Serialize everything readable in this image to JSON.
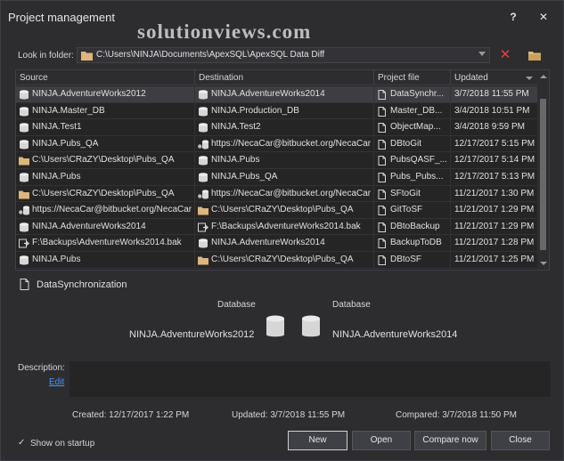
{
  "window": {
    "title": "Project management",
    "help_label": "?",
    "close_label": "✕",
    "watermark": "solutionviews.com"
  },
  "look_in": {
    "label": "Look in folder:",
    "path": "C:\\Users\\NINJA\\Documents\\ApexSQL\\ApexSQL Data Diff"
  },
  "grid": {
    "columns": [
      "Source",
      "Destination",
      "Project file",
      "Updated"
    ],
    "rows": [
      {
        "src": "NINJA.AdventureWorks2012",
        "src_icon": "database-icon",
        "dst": "NINJA.AdventureWorks2014",
        "dst_icon": "database-icon",
        "file": "DataSynchr...",
        "updated": "3/7/2018 11:55 PM"
      },
      {
        "src": "NINJA.Master_DB",
        "src_icon": "database-icon",
        "dst": "NINJA.Production_DB",
        "dst_icon": "database-icon",
        "file": "Master_DB...",
        "updated": "3/4/2018 10:51 PM"
      },
      {
        "src": "NINJA.Test1",
        "src_icon": "database-icon",
        "dst": "NINJA.Test2",
        "dst_icon": "database-icon",
        "file": "ObjectMap...",
        "updated": "3/4/2018 9:59 PM"
      },
      {
        "src": "NINJA.Pubs_QA",
        "src_icon": "database-icon",
        "dst": "https://NecaCar@bitbucket.org/NecaCar",
        "dst_icon": "source-control-icon",
        "file": "DBtoGit",
        "updated": "12/17/2017 5:15 PM"
      },
      {
        "src": "C:\\Users\\CRaZY\\Desktop\\Pubs_QA",
        "src_icon": "folder-icon",
        "dst": "NINJA.Pubs",
        "dst_icon": "database-icon",
        "file": "PubsQASF_...",
        "updated": "12/17/2017 5:14 PM"
      },
      {
        "src": "NINJA.Pubs",
        "src_icon": "database-icon",
        "dst": "NINJA.Pubs_QA",
        "dst_icon": "database-icon",
        "file": "Pubs_Pubs...",
        "updated": "12/17/2017 5:13 PM"
      },
      {
        "src": "C:\\Users\\CRaZY\\Desktop\\Pubs_QA",
        "src_icon": "folder-icon",
        "dst": "https://NecaCar@bitbucket.org/NecaCar",
        "dst_icon": "source-control-icon",
        "file": "SFtoGit",
        "updated": "11/21/2017 1:30 PM"
      },
      {
        "src": "https://NecaCar@bitbucket.org/NecaCar",
        "src_icon": "source-control-icon",
        "dst": "C:\\Users\\CRaZY\\Desktop\\Pubs_QA",
        "dst_icon": "folder-icon",
        "file": "GitToSF",
        "updated": "11/21/2017 1:29 PM"
      },
      {
        "src": "NINJA.AdventureWorks2014",
        "src_icon": "database-icon",
        "dst": "F:\\Backups\\AdventureWorks2014.bak",
        "dst_icon": "backup-icon",
        "file": "DBtoBackup",
        "updated": "11/21/2017 1:29 PM"
      },
      {
        "src": "F:\\Backups\\AdventureWorks2014.bak",
        "src_icon": "backup-icon",
        "dst": "NINJA.AdventureWorks2014",
        "dst_icon": "database-icon",
        "file": "BackupToDB",
        "updated": "11/21/2017 1:28 PM"
      },
      {
        "src": "NINJA.Pubs",
        "src_icon": "database-icon",
        "dst": "C:\\Users\\CRaZY\\Desktop\\Pubs_QA",
        "dst_icon": "folder-icon",
        "file": "DBtoSF",
        "updated": "11/21/2017 1:25 PM"
      }
    ]
  },
  "details": {
    "project_name": "DataSynchronization",
    "source_label": "Database",
    "destination_label": "Database",
    "source_name": "NINJA.AdventureWorks2012",
    "destination_name": "NINJA.AdventureWorks2014",
    "description_label": "Description:",
    "edit_label": "Edit",
    "created": "Created: 12/17/2017 1:22 PM",
    "updated": "Updated: 3/7/2018 11:55 PM",
    "compared": "Compared: 3/7/2018 11:50 PM"
  },
  "footer": {
    "show_on_startup_label": "Show on startup",
    "new_label": "New",
    "open_label": "Open",
    "compare_label": "Compare now",
    "close_label": "Close"
  },
  "colors": {
    "accent_link": "#3e9cf5",
    "clear_red": "#e04343",
    "folder_yellow": "#dcb67a"
  }
}
